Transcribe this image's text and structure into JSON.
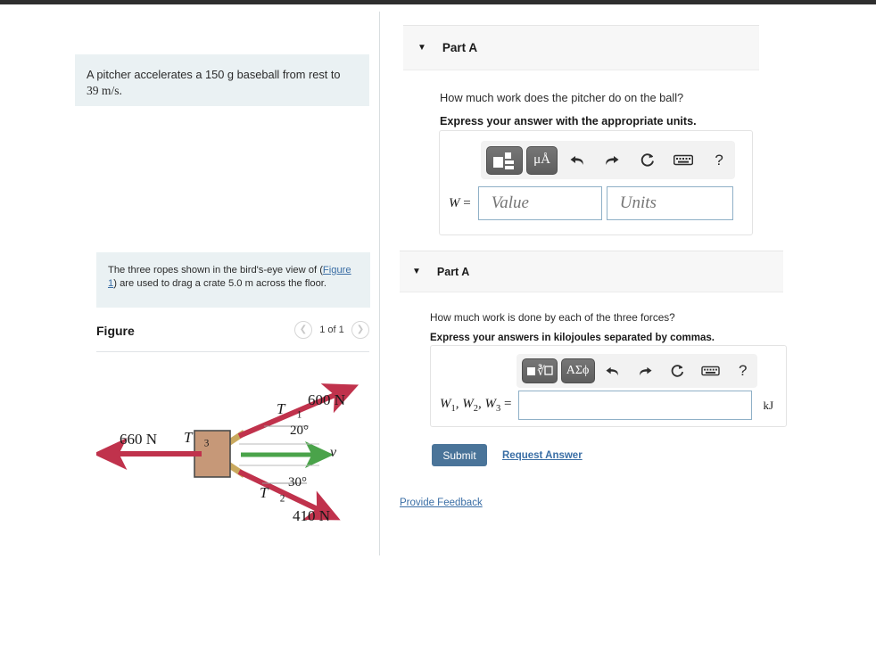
{
  "topbar": {
    "present": true,
    "color": "#2e2e2e"
  },
  "left": {
    "problem1": {
      "text_part1": "A pitcher accelerates a 150 g baseball from rest to ",
      "text_math": "39 m/s."
    },
    "problem2": {
      "text_part1": "The three ropes shown in the bird's-eye view of (",
      "link_label": "Figure 1",
      "text_part2": ") are used to drag a crate 5.0 m across the floor."
    },
    "figure": {
      "title": "Figure",
      "prev_icon": "chevron-left-icon",
      "next_icon": "chevron-right-icon",
      "counter": "1 of 1",
      "diagram": {
        "t1_label": "T⃗1",
        "t1_magnitude": "600 N",
        "t1_angle": "20°",
        "t2_label": "T⃗2",
        "t2_magnitude": "410 N",
        "t2_angle": "30°",
        "t3_label": "T⃗3",
        "t3_magnitude": "660 N",
        "velocity_label": "v⃗",
        "crate_color": "#c69878",
        "force_color": "#c0324c",
        "velocity_color": "#4aa34a",
        "rope_color": "#c9a95e"
      }
    }
  },
  "panels": [
    {
      "id": "panel-1",
      "caret_icon": "caret-down-icon",
      "title": "Part A",
      "question": "How much work does the pitcher do on the ball?",
      "instruction": "Express your answer with the appropriate units.",
      "toolbar": {
        "template_icon": "math-template-icon",
        "units_label": "μÅ",
        "undo_icon": "undo-arrow-icon",
        "redo_icon": "redo-arrow-icon",
        "reset_icon": "reset-circular-arrow-icon",
        "keyboard_icon": "keyboard-icon",
        "help_label": "?"
      },
      "answer": {
        "var_label": "W",
        "equals": "=",
        "value_placeholder": "Value",
        "value": "",
        "units_placeholder": "Units",
        "units": ""
      }
    },
    {
      "id": "panel-2",
      "caret_icon": "caret-down-icon",
      "title": "Part A",
      "question": "How much work is done by each of the three forces?",
      "instruction": "Express your answers in kilojoules separated by commas.",
      "toolbar": {
        "template_icon": "sqrt-template-icon",
        "greek_label": "ΑΣϕ",
        "undo_icon": "undo-arrow-icon",
        "redo_icon": "redo-arrow-icon",
        "reset_icon": "reset-circular-arrow-icon",
        "keyboard_icon": "keyboard-icon",
        "help_label": "?"
      },
      "answer": {
        "var_label_1": "W",
        "var_sub_1": "1",
        "var_label_2": "W",
        "var_sub_2": "2",
        "var_label_3": "W",
        "var_sub_3": "3",
        "equals": "=",
        "value": "",
        "placeholder": "",
        "unit_suffix": "kJ"
      },
      "actions": {
        "submit_label": "Submit",
        "request_answer_label": "Request Answer"
      }
    }
  ],
  "footer": {
    "provide_feedback_label": "Provide Feedback"
  }
}
